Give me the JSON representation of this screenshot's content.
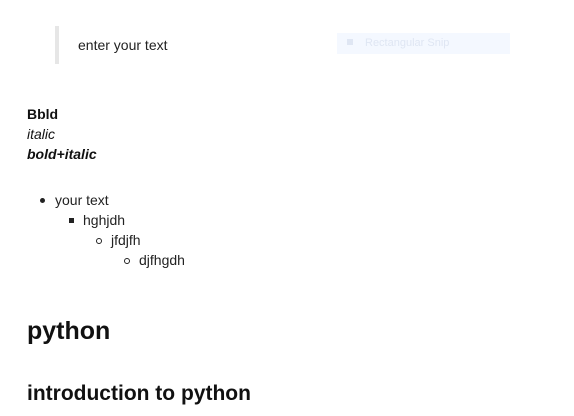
{
  "blockquote": {
    "text": "enter your text"
  },
  "snip_tool": {
    "label": "Rectangular Snip",
    "icon": "snip-icon"
  },
  "formatting": {
    "bold": "Bbld",
    "italic": "italic",
    "bold_italic": "bold+italic"
  },
  "nested_list": {
    "level1": "your text",
    "level2": "hghjdh",
    "level3": "jfdjfh",
    "level4": "djfhgdh"
  },
  "headings": {
    "h1": "python",
    "h2": "introduction to python"
  }
}
